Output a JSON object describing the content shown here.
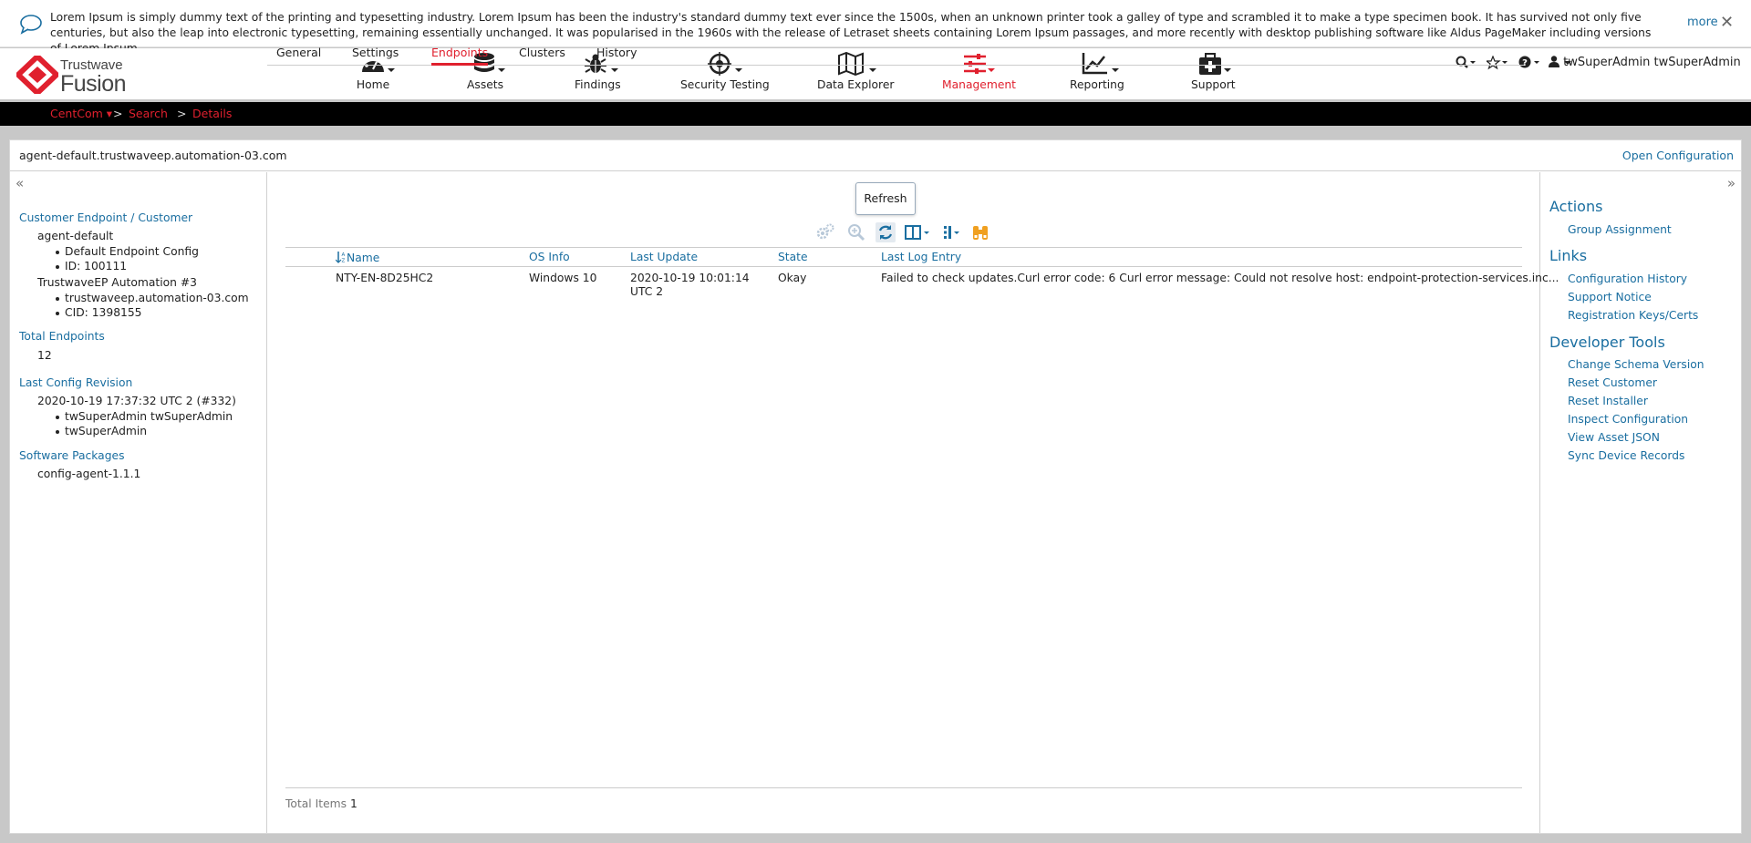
{
  "notice": {
    "text": "Lorem Ipsum is simply dummy text of the printing and typesetting industry. Lorem Ipsum has been the industry's standard dummy text ever since the 1500s, when an unknown printer took a galley of type and scrambled it to make a type specimen book. It has survived not only five centuries, but also the leap into electronic typesetting, remaining essentially unchanged. It was popularised in the 1960s with the release of Letraset sheets containing Lorem Ipsum passages, and more recently with desktop publishing software like Aldus PageMaker including versions of Lorem Ipsum.",
    "more_label": "more",
    "close_glyph": "✕"
  },
  "brand": {
    "top": "Trustwave",
    "name": "Fusion",
    "color": "#e0202e"
  },
  "nav": [
    {
      "label": "Home",
      "icon": "dashboard-icon"
    },
    {
      "label": "Assets",
      "icon": "database-icon"
    },
    {
      "label": "Findings",
      "icon": "bug-icon"
    },
    {
      "label": "Security Testing",
      "icon": "target-icon"
    },
    {
      "label": "Data Explorer",
      "icon": "map-icon"
    },
    {
      "label": "Management",
      "icon": "sliders-icon",
      "active": true
    },
    {
      "label": "Reporting",
      "icon": "chart-icon"
    },
    {
      "label": "Support",
      "icon": "medkit-icon"
    }
  ],
  "user": {
    "name": "twSuperAdmin twSuperAdmin"
  },
  "breadcrumb": {
    "root": "CentCom",
    "sep1": ">",
    "search": "Search",
    "sep2": ">",
    "details": "Details"
  },
  "panel": {
    "title": "agent-default.trustwaveep.automation-03.com",
    "open_config": "Open Configuration",
    "collapse_left": "«",
    "collapse_right": "»"
  },
  "left": {
    "customer_header": "Customer Endpoint / Customer",
    "endpoint_name": "agent-default",
    "endpoint_desc": "Default Endpoint Config",
    "endpoint_id": "ID: 100111",
    "customer_name": "TrustwaveEP Automation #3",
    "customer_domain": "trustwaveep.automation-03.com",
    "customer_cid": "CID: 1398155",
    "total_header": "Total Endpoints",
    "total_value": "12",
    "revision_header": "Last Config Revision",
    "revision_value": "2020-10-19 17:37:32 UTC 2 (#332)",
    "revision_user1": "twSuperAdmin twSuperAdmin",
    "revision_user2": "twSuperAdmin",
    "packages_header": "Software Packages",
    "package": "config-agent-1.1.1"
  },
  "tabs": [
    {
      "label": "General"
    },
    {
      "label": "Settings"
    },
    {
      "label": "Endpoints",
      "active": true
    },
    {
      "label": "Clusters"
    },
    {
      "label": "History"
    }
  ],
  "tooltip": "Refresh",
  "toolbar": [
    "settings-icon",
    "zoom-icon",
    "refresh-icon",
    "columns-icon",
    "list-icon",
    "binoculars-icon"
  ],
  "grid": {
    "columns": [
      "Name",
      "OS Info",
      "Last Update",
      "State",
      "Last Log Entry"
    ],
    "rows": [
      {
        "name": "NTY-EN-8D25HC2",
        "os": "Windows 10",
        "updated_line1": "2020-10-19 10:01:14",
        "updated_line2": "UTC 2",
        "state": "Okay",
        "log": "Failed to check updates.Curl error code: 6 Curl error message: Could not resolve host: endpoint-protection-services.inc..."
      }
    ],
    "total_label": "Total Items",
    "total_value": "1"
  },
  "right": {
    "actions_header": "Actions",
    "actions": [
      "Group Assignment"
    ],
    "links_header": "Links",
    "links": [
      "Configuration History",
      "Support Notice",
      "Registration Keys/Certs"
    ],
    "dev_header": "Developer Tools",
    "dev": [
      "Change Schema Version",
      "Reset Customer",
      "Reset Installer",
      "Inspect Configuration",
      "View Asset JSON",
      "Sync Device Records"
    ]
  }
}
